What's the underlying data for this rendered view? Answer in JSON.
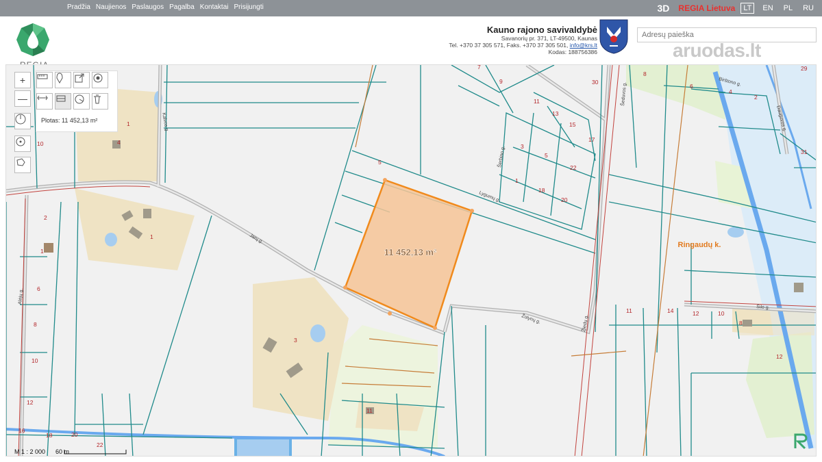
{
  "topnav": [
    "Pradžia",
    "Naujienos",
    "Paslaugos",
    "Pagalba",
    "Kontaktai",
    "Prisijungti"
  ],
  "top_right": {
    "mode_3d": "3D",
    "brand": "REGIA Lietuva",
    "languages": [
      "LT",
      "EN",
      "PL",
      "RU"
    ],
    "active_language": "LT"
  },
  "logo": {
    "text": "REGIA"
  },
  "municipality": {
    "name": "Kauno rajono savivaldybė",
    "address": "Savanorių pr. 371, LT-49500, Kaunas",
    "phone": "Tel. +370 37 305 571, Faks. +370 37 305 501,",
    "email": "info@krs.lt",
    "code": "Kodas: 188756386"
  },
  "search": {
    "placeholder": "Adresų paieška"
  },
  "watermark": "aruodas.lt",
  "toolbar": {
    "area_label": "Plotas: 11 452,13 m²",
    "zoom_in": "+",
    "zoom_out": "—"
  },
  "map": {
    "polygon_label": "11 452,13 m²",
    "village_label": "Ringaudų k.",
    "streets": [
      "Jarų g.",
      "Lygumų g.",
      "Žolynų g.",
      "Žiedų g.",
      "Kalvos g.",
      "Šerbino g.",
      "Alėjų g.",
      "Šilo g.",
      "Šeduvos g.",
      "Birštono g.",
      "Dauguvos g."
    ],
    "parcel_numbers": [
      "7",
      "9",
      "11",
      "13",
      "15",
      "17",
      "3",
      "5",
      "22",
      "1",
      "18",
      "20",
      "5",
      "30",
      "29",
      "8",
      "6",
      "4",
      "2",
      "31",
      "2",
      "6",
      "8",
      "10",
      "12",
      "16",
      "18",
      "20",
      "22",
      "11",
      "14",
      "12",
      "10",
      "8",
      "12",
      "1",
      "4",
      "10",
      "3",
      "1",
      "11",
      "1"
    ]
  },
  "scale": {
    "ratio": "M 1 : 2 000",
    "distance": "60 m"
  },
  "colors": {
    "parcel_line": "#1f8a8a",
    "road": "#a9a9a9",
    "polygon_fill": "#f6c497",
    "polygon_stroke": "#f08a1c",
    "building_area": "#efe3c4",
    "water": "#a6cdf0",
    "number_red": "#b3262a",
    "village_text": "#e27a1e"
  }
}
